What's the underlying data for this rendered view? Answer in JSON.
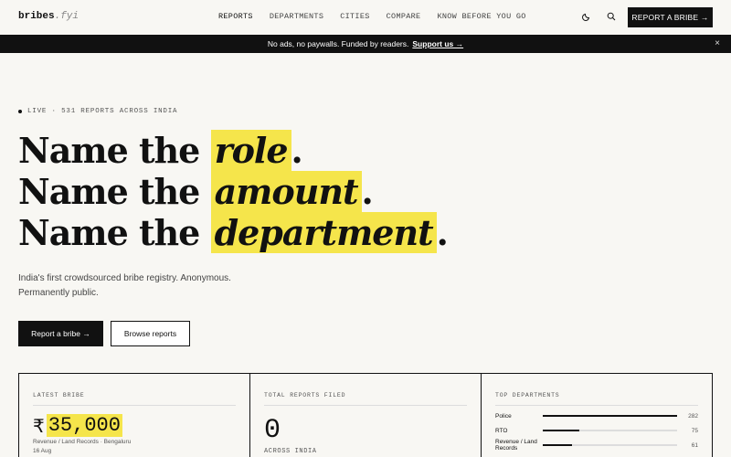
{
  "logo": {
    "name": "bribes",
    "ext": ".fyi"
  },
  "nav": {
    "items": [
      "REPORTS",
      "DEPARTMENTS",
      "CITIES",
      "COMPARE",
      "KNOW BEFORE YOU GO"
    ]
  },
  "header": {
    "report_button": "REPORT A BRIBE →"
  },
  "banner": {
    "text": "No ads, no paywalls. Funded by readers.",
    "support": "Support us →",
    "close": "×"
  },
  "hero": {
    "live": "LIVE · 531 REPORTS ACROSS INDIA",
    "lines": [
      {
        "prefix": "Name the",
        "highlight": "role",
        "suffix": "."
      },
      {
        "prefix": "Name the",
        "highlight": "amount",
        "suffix": "."
      },
      {
        "prefix": "Name the",
        "highlight": "department",
        "suffix": "."
      }
    ],
    "subtitle": "India's first crowdsourced bribe registry. Anonymous. Permanently public.",
    "primary_button": "Report a bribe →",
    "secondary_button": "Browse reports"
  },
  "cards": {
    "latest": {
      "label": "LATEST BRIBE",
      "currency": "₹",
      "amount": "35,000",
      "category": "Revenue / Land Records · Bengaluru",
      "date": "16 Aug"
    },
    "total": {
      "label": "TOTAL REPORTS FILED",
      "value": "0",
      "sub": "ACROSS INDIA"
    },
    "top": {
      "label": "TOP DEPARTMENTS",
      "departments": [
        {
          "name": "Police",
          "count": "282",
          "share": 1.0
        },
        {
          "name": "RTO",
          "count": "75",
          "share": 0.27
        },
        {
          "name": "Revenue / Land Records",
          "count": "61",
          "share": 0.22
        }
      ]
    }
  },
  "colors": {
    "accent": "#f5e54b",
    "ink": "#111111",
    "paper": "#f8f7f3"
  }
}
